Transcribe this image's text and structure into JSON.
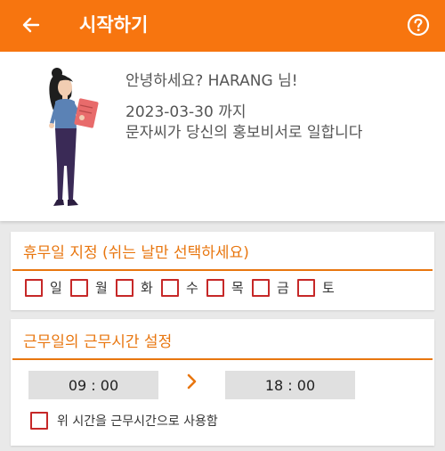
{
  "appbar": {
    "title": "시작하기",
    "back_icon": "arrow-left-icon",
    "help_icon": "question-circle-icon",
    "color": "#f7750f"
  },
  "profile": {
    "greeting": "안녕하세요? HARANG 님!",
    "deadline": "2023-03-30 까지",
    "notice": "문자씨가 당신의 홍보비서로 일합니다"
  },
  "holiday": {
    "title": "휴무일 지정 (쉬는 날만 선택하세요)",
    "days": [
      {
        "label": "일",
        "checked": false
      },
      {
        "label": "월",
        "checked": false
      },
      {
        "label": "화",
        "checked": false
      },
      {
        "label": "수",
        "checked": false
      },
      {
        "label": "목",
        "checked": false
      },
      {
        "label": "금",
        "checked": false
      },
      {
        "label": "토",
        "checked": false
      }
    ]
  },
  "hours": {
    "title": "근무일의 근무시간 설정",
    "start": "09 : 00",
    "end": "18 : 00",
    "separator_icon": "chevron-right-icon",
    "use_label": "위 시간을 근무시간으로 사용함",
    "use_checked": false
  },
  "colors": {
    "accent": "#e8760f",
    "checkbox_border": "#c62828"
  }
}
